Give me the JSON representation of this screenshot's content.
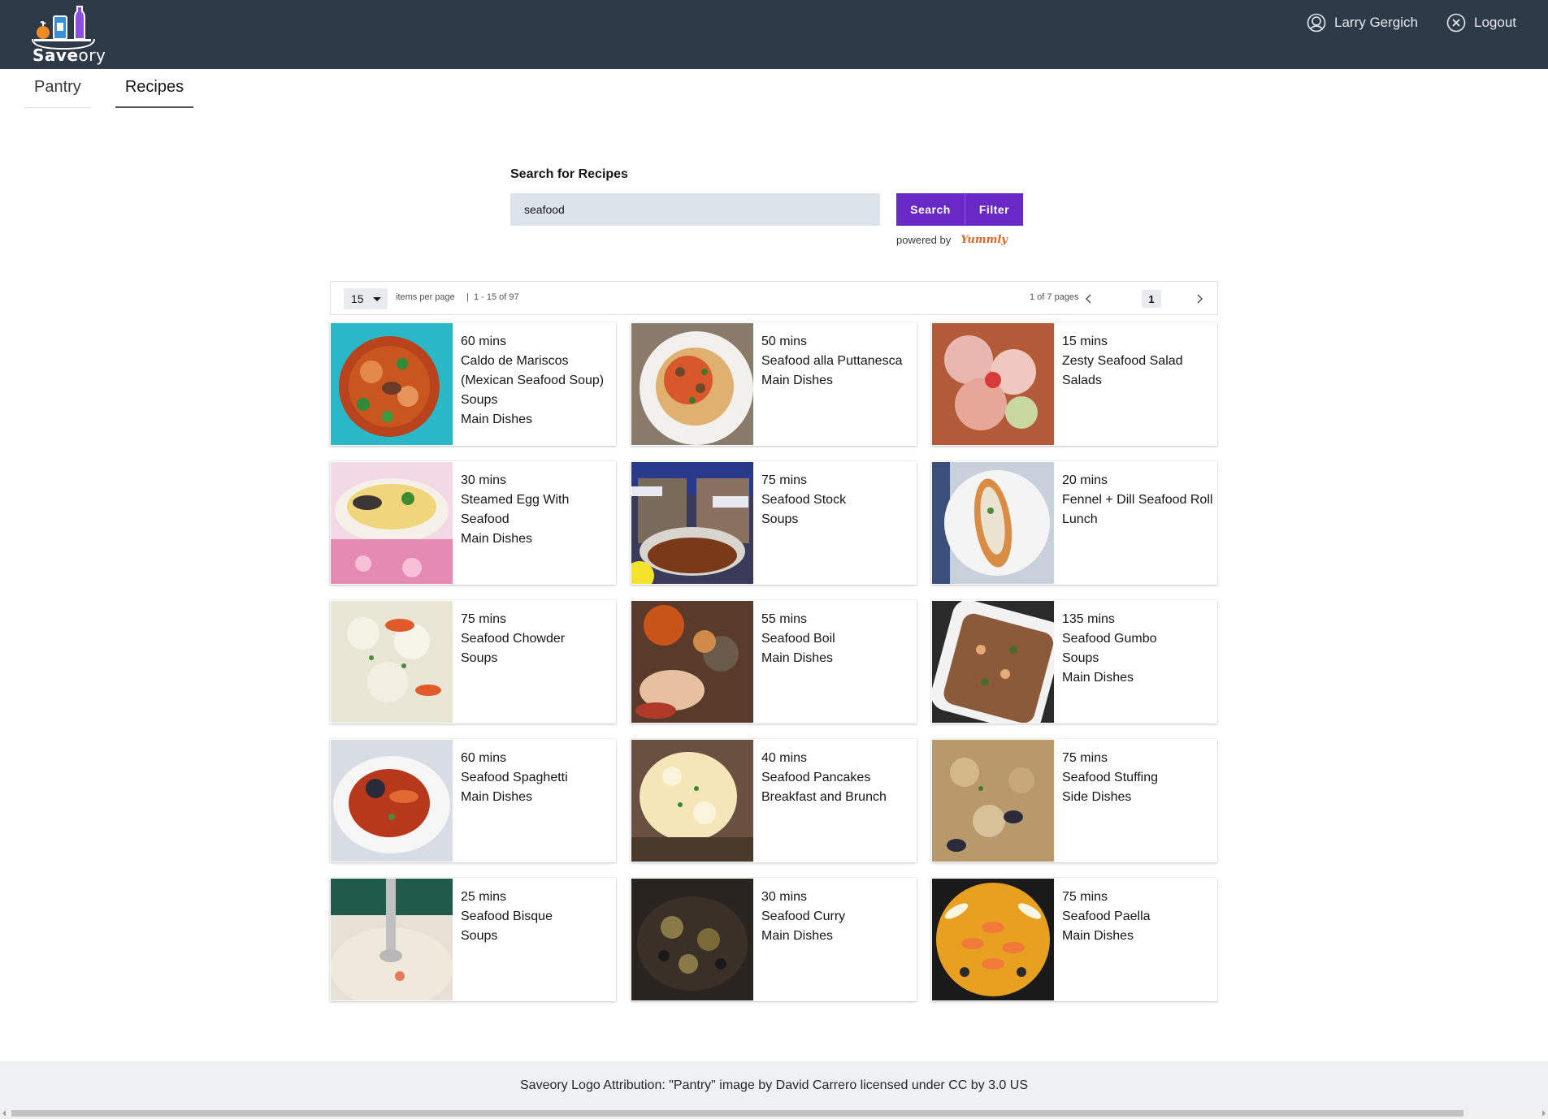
{
  "app": {
    "logo_text_bold": "Save",
    "logo_text_light": "ory",
    "user_name": "Larry Gergich",
    "logout_label": "Logout",
    "user_icon": "user-avatar-icon",
    "logout_icon": "close-circle-icon"
  },
  "tabs": [
    {
      "label": "Pantry",
      "active": false
    },
    {
      "label": "Recipes",
      "active": true
    }
  ],
  "search": {
    "label": "Search for Recipes",
    "value": "seafood",
    "search_button": "Search",
    "filter_button": "Filter",
    "powered_by": "powered by",
    "provider": "Yummly"
  },
  "pagination": {
    "items_per_page": "15",
    "items_per_page_label": "items per page",
    "separator": "|",
    "range": "1 - 15 of 97",
    "pages_label": "1 of 7 pages",
    "current_page": "1"
  },
  "recipes": [
    {
      "time": "60 mins",
      "name": "Caldo de Mariscos (Mexican Seafood Soup)",
      "courses": [
        "Soups",
        "Main Dishes"
      ]
    },
    {
      "time": "50 mins",
      "name": "Seafood alla Puttanesca",
      "courses": [
        "Main Dishes"
      ]
    },
    {
      "time": "15 mins",
      "name": "Zesty Seafood Salad",
      "courses": [
        "Salads"
      ]
    },
    {
      "time": "30 mins",
      "name": "Steamed Egg With Seafood",
      "courses": [
        "Main Dishes"
      ]
    },
    {
      "time": "75 mins",
      "name": "Seafood Stock",
      "courses": [
        "Soups"
      ]
    },
    {
      "time": "20 mins",
      "name": "Fennel + Dill Seafood Roll",
      "courses": [
        "Lunch"
      ]
    },
    {
      "time": "75 mins",
      "name": "Seafood Chowder",
      "courses": [
        "Soups"
      ]
    },
    {
      "time": "55 mins",
      "name": "Seafood Boil",
      "courses": [
        "Main Dishes"
      ]
    },
    {
      "time": "135 mins",
      "name": "Seafood Gumbo",
      "courses": [
        "Soups",
        "Main Dishes"
      ]
    },
    {
      "time": "60 mins",
      "name": "Seafood Spaghetti",
      "courses": [
        "Main Dishes"
      ]
    },
    {
      "time": "40 mins",
      "name": "Seafood Pancakes",
      "courses": [
        "Breakfast and Brunch"
      ]
    },
    {
      "time": "75 mins",
      "name": "Seafood Stuffing",
      "courses": [
        "Side Dishes"
      ]
    },
    {
      "time": "25 mins",
      "name": "Seafood Bisque",
      "courses": [
        "Soups"
      ]
    },
    {
      "time": "30 mins",
      "name": "Seafood Curry",
      "courses": [
        "Main Dishes"
      ]
    },
    {
      "time": "75 mins",
      "name": "Seafood Paella",
      "courses": [
        "Main Dishes"
      ]
    }
  ],
  "footer": {
    "text": "Saveory Logo Attribution: \"Pantry\" image by David Carrero licensed under CC by 3.0 US"
  },
  "colors": {
    "header_bg": "#2f3a49",
    "accent": "#6929c4",
    "input_bg": "#dde3ea",
    "footer_bg": "#eef0f4"
  }
}
